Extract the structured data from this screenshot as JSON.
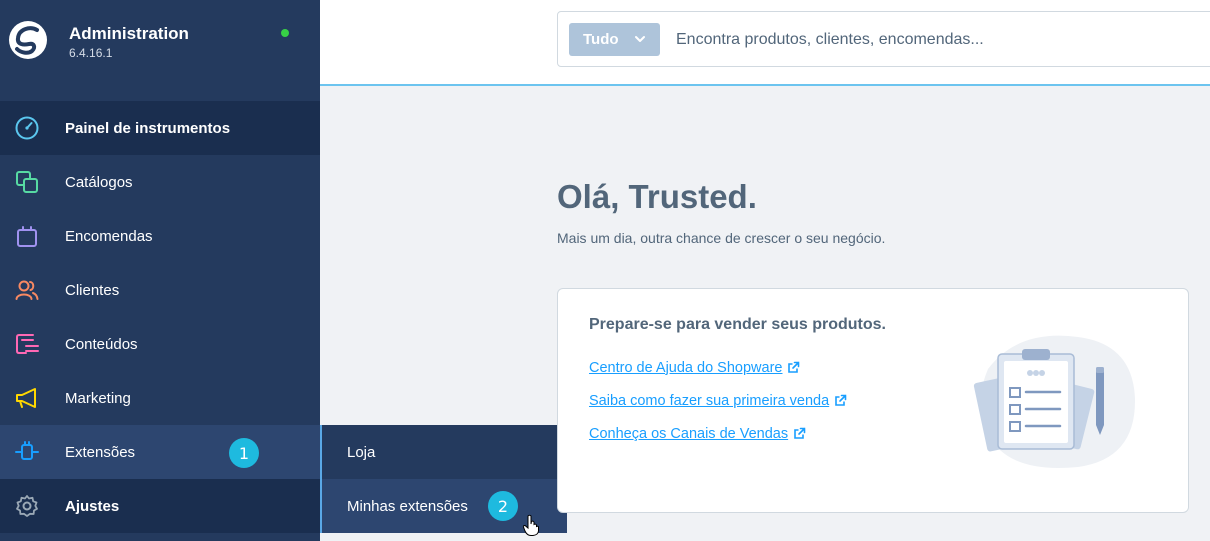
{
  "app": {
    "title": "Administration",
    "version": "6.4.16.1",
    "status_color": "#37d046"
  },
  "sidebar": {
    "items": [
      {
        "label": "Painel de instrumentos",
        "icon": "dashboard-icon",
        "color": "#5bc7ef"
      },
      {
        "label": "Catálogos",
        "icon": "catalog-icon",
        "color": "#57d9a3"
      },
      {
        "label": "Encomendas",
        "icon": "shopping-bag-icon",
        "color": "#a092f0"
      },
      {
        "label": "Clientes",
        "icon": "users-icon",
        "color": "#f88962"
      },
      {
        "label": "Conteúdos",
        "icon": "content-icon",
        "color": "#ff68b4"
      },
      {
        "label": "Marketing",
        "icon": "megaphone-icon",
        "color": "#ffd700"
      },
      {
        "label": "Extensões",
        "icon": "plug-icon",
        "color": "#189eff"
      },
      {
        "label": "Ajustes",
        "icon": "gear-icon",
        "color": "#9aa8b5"
      }
    ],
    "badge_extensions": "1"
  },
  "flyout": {
    "items": [
      {
        "label": "Loja"
      },
      {
        "label": "Minhas extensões"
      }
    ],
    "badge_my_extensions": "2"
  },
  "search": {
    "type_label": "Tudo",
    "placeholder": "Encontra produtos, clientes, encomendas..."
  },
  "main": {
    "greeting": "Olá, Trusted.",
    "subtitle": "Mais um dia, outra chance de crescer o seu negócio.",
    "card": {
      "title": "Prepare-se para vender seus produtos.",
      "links": [
        "Centro de Ajuda do Shopware",
        "Saiba como fazer sua primeira venda",
        "Conheça os Canais de Vendas"
      ]
    }
  }
}
